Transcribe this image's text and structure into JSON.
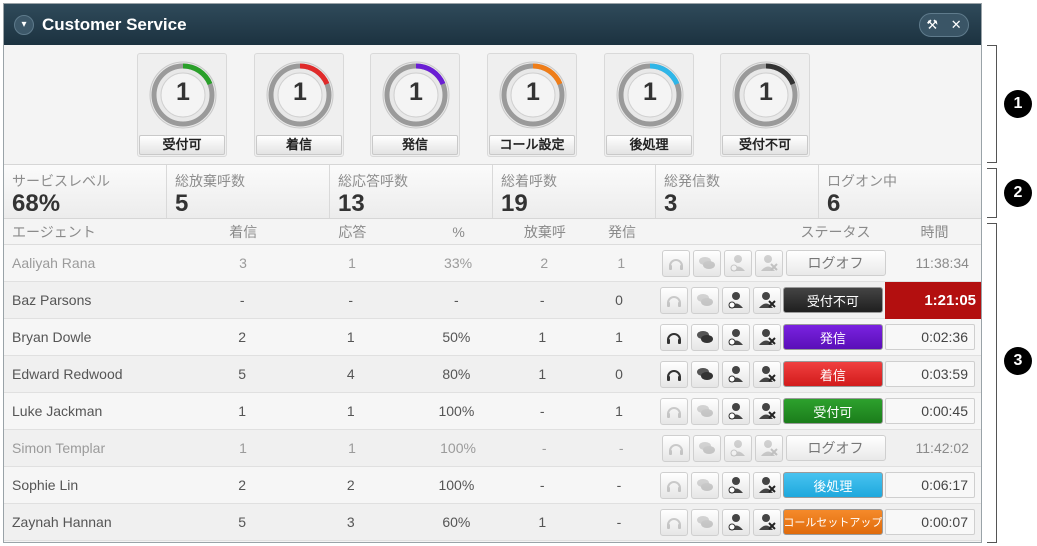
{
  "header": {
    "title": "Customer Service",
    "collapse_icon": "▾",
    "tool_icon": "⚒",
    "close_icon": "✕"
  },
  "gauges": [
    {
      "label": "受付可",
      "value": "1",
      "color": "#2aa02a"
    },
    {
      "label": "着信",
      "value": "1",
      "color": "#e02a2a"
    },
    {
      "label": "発信",
      "value": "1",
      "color": "#6a1ed4"
    },
    {
      "label": "コール設定",
      "value": "1",
      "color": "#ef7d18"
    },
    {
      "label": "後処理",
      "value": "1",
      "color": "#2fb6e8"
    },
    {
      "label": "受付不可",
      "value": "1",
      "color": "#333333"
    }
  ],
  "stats": [
    {
      "label": "サービスレベル",
      "value": "68%"
    },
    {
      "label": "総放棄呼数",
      "value": "5"
    },
    {
      "label": "総応答呼数",
      "value": "13"
    },
    {
      "label": "総着呼数",
      "value": "19"
    },
    {
      "label": "総発信数",
      "value": "3"
    },
    {
      "label": "ログオン中",
      "value": "6"
    }
  ],
  "columns": {
    "agent": "エージェント",
    "incoming": "着信",
    "answered": "応答",
    "percent": "%",
    "abandoned": "放棄呼",
    "outgoing": "発信",
    "status": "ステータス",
    "time": "時間"
  },
  "rows": [
    {
      "name": "Aaliyah Rana",
      "incoming": "3",
      "answered": "1",
      "percent": "33%",
      "abandoned": "2",
      "outgoing": "1",
      "status": "ログオフ",
      "time": "11:38:34"
    },
    {
      "name": "Baz Parsons",
      "incoming": "-",
      "answered": "-",
      "percent": "-",
      "abandoned": "-",
      "outgoing": "0",
      "status": "受付不可",
      "time": "1:21:05"
    },
    {
      "name": "Bryan Dowle",
      "incoming": "2",
      "answered": "1",
      "percent": "50%",
      "abandoned": "1",
      "outgoing": "1",
      "status": "発信",
      "time": "0:02:36"
    },
    {
      "name": "Edward Redwood",
      "incoming": "5",
      "answered": "4",
      "percent": "80%",
      "abandoned": "1",
      "outgoing": "0",
      "status": "着信",
      "time": "0:03:59"
    },
    {
      "name": "Luke Jackman",
      "incoming": "1",
      "answered": "1",
      "percent": "100%",
      "abandoned": "-",
      "outgoing": "1",
      "status": "受付可",
      "time": "0:00:45"
    },
    {
      "name": "Simon Templar",
      "incoming": "1",
      "answered": "1",
      "percent": "100%",
      "abandoned": "-",
      "outgoing": "-",
      "status": "ログオフ",
      "time": "11:42:02"
    },
    {
      "name": "Sophie Lin",
      "incoming": "2",
      "answered": "2",
      "percent": "100%",
      "abandoned": "-",
      "outgoing": "-",
      "status": "後処理",
      "time": "0:06:17"
    },
    {
      "name": "Zaynah Hannan",
      "incoming": "5",
      "answered": "3",
      "percent": "60%",
      "abandoned": "1",
      "outgoing": "-",
      "status": "コールセットアップ",
      "time": "0:00:07"
    }
  ],
  "callouts": [
    "1",
    "2",
    "3"
  ]
}
